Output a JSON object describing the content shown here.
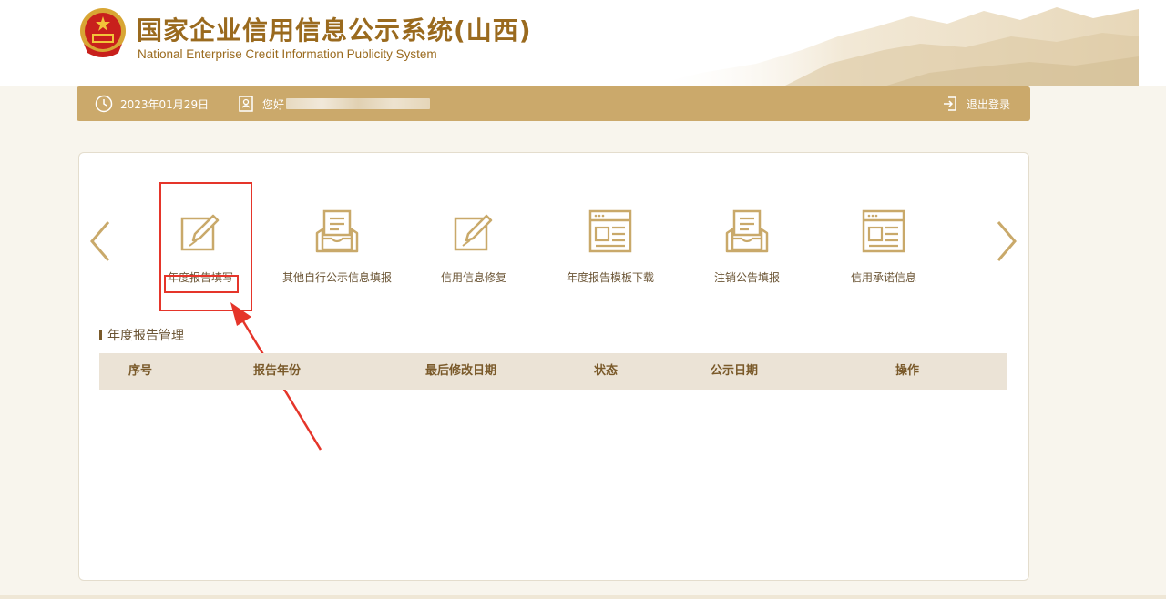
{
  "header": {
    "title": "国家企业信用信息公示系统(山西)",
    "subtitle": "National Enterprise Credit Information Publicity System"
  },
  "toolbar": {
    "date": "2023年01月29日",
    "greeting": "您好",
    "logout_label": "退出登录"
  },
  "functions": [
    {
      "label": "年度报告填写",
      "icon": "edit-icon"
    },
    {
      "label": "其他自行公示信息填报",
      "icon": "inbox-document-icon"
    },
    {
      "label": "信用信息修复",
      "icon": "edit-icon"
    },
    {
      "label": "年度报告模板下载",
      "icon": "template-icon"
    },
    {
      "label": "注销公告填报",
      "icon": "inbox-document-icon"
    },
    {
      "label": "信用承诺信息",
      "icon": "template-icon"
    }
  ],
  "section": {
    "title": "年度报告管理"
  },
  "table": {
    "columns": [
      "序号",
      "报告年份",
      "最后修改日期",
      "状态",
      "公示日期",
      "操作"
    ],
    "rows": []
  },
  "colors": {
    "brand_gold": "#cba96b",
    "title_brown": "#9a6a1e",
    "highlight_red": "#e5352a"
  }
}
